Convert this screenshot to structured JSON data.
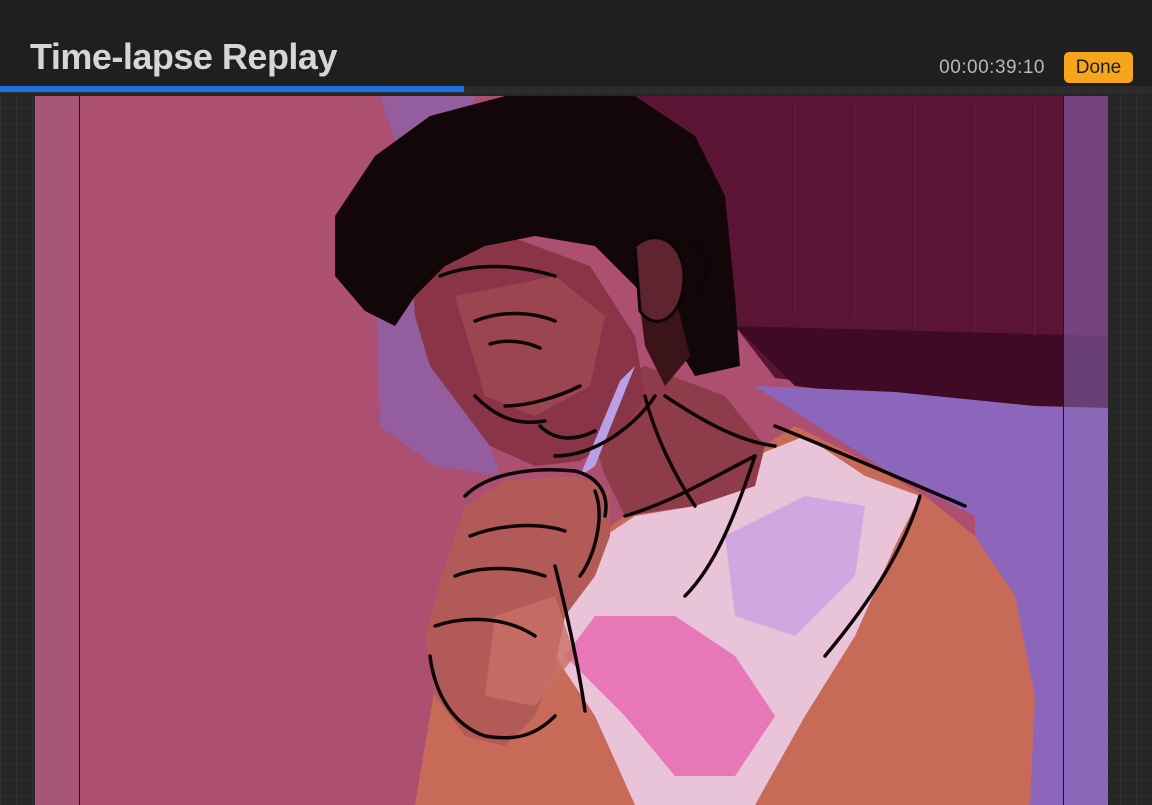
{
  "header": {
    "title": "Time-lapse Replay",
    "timecode": "00:00:39:10",
    "done_label": "Done"
  },
  "playback": {
    "progress": 0.403
  },
  "colors": {
    "accent": "#1e6fe0",
    "done_button": "#f7a51b"
  }
}
